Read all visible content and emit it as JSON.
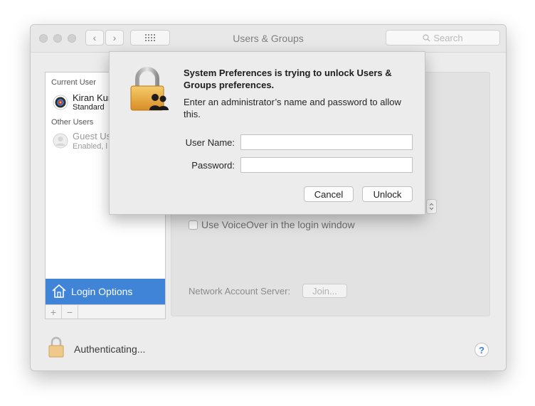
{
  "window": {
    "title": "Users & Groups"
  },
  "toolbar": {
    "back_glyph": "‹",
    "forward_glyph": "›",
    "search_placeholder": "Search"
  },
  "sidebar": {
    "current_user_heading": "Current User",
    "current_user": {
      "name": "Kiran Kur",
      "role": "Standard"
    },
    "other_users_heading": "Other Users",
    "guest_user": {
      "name": "Guest Us",
      "status": "Enabled, l"
    },
    "login_options_label": "Login Options",
    "add_glyph": "+",
    "remove_glyph": "−"
  },
  "main": {
    "voiceover_label": "Use VoiceOver in the login window",
    "voiceover_checked": false,
    "network_server_label": "Network Account Server:",
    "join_label": "Join..."
  },
  "footer": {
    "status_text": "Authenticating...",
    "help_glyph": "?"
  },
  "dialog": {
    "heading": "System Preferences is trying to unlock Users & Groups preferences.",
    "body": "Enter an administrator’s name and password to allow this.",
    "username_label": "User Name:",
    "username_value": "",
    "password_label": "Password:",
    "password_value": "",
    "cancel_label": "Cancel",
    "unlock_label": "Unlock"
  },
  "colors": {
    "selection": "#3f84d7",
    "lock_gold": "#e9a93c",
    "window_bg": "#ececec"
  }
}
